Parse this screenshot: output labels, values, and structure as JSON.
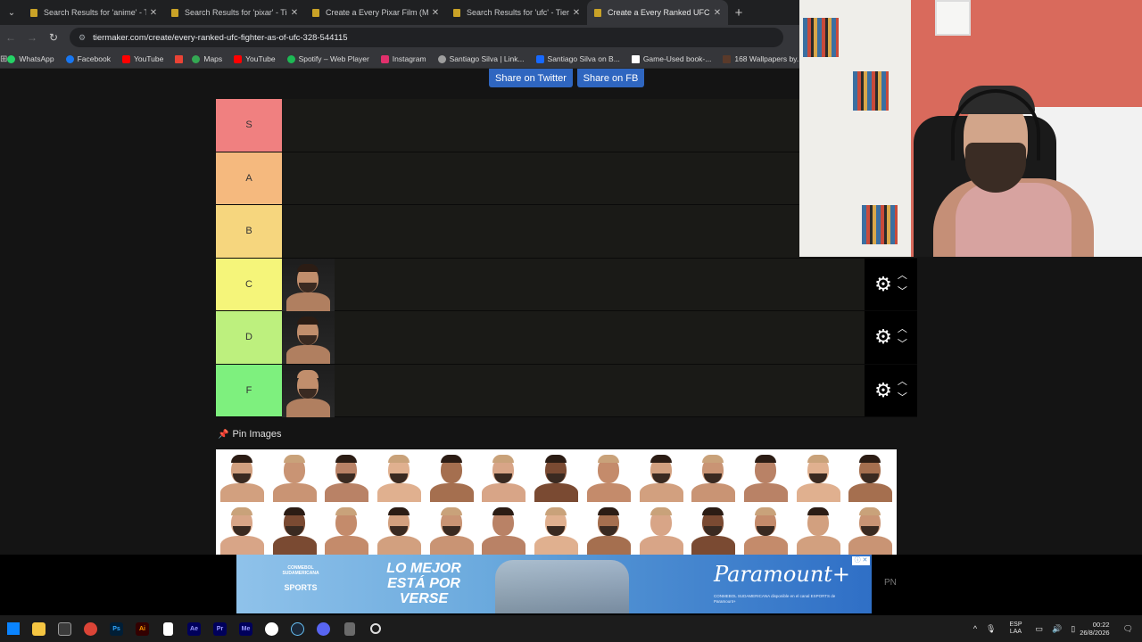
{
  "browser": {
    "tabs": [
      {
        "title": "Search Results for 'anime' - Tier",
        "active": false
      },
      {
        "title": "Search Results for 'pixar' - TierM",
        "active": false
      },
      {
        "title": "Create a Every Pixar Film (Marc",
        "active": false
      },
      {
        "title": "Search Results for 'ufc' - TierMa",
        "active": false
      },
      {
        "title": "Create a Every Ranked UFC Figh",
        "active": true
      }
    ],
    "url": "tiermaker.com/create/every-ranked-ufc-fighter-as-of-ufc-328-544115",
    "bookmarks": [
      {
        "label": "WhatsApp",
        "color": "#25d366"
      },
      {
        "label": "Facebook",
        "color": "#1877f2"
      },
      {
        "label": "YouTube",
        "color": "#ff0000"
      },
      {
        "label": "",
        "color": "#ea4335"
      },
      {
        "label": "Maps",
        "color": "#34a853"
      },
      {
        "label": "YouTube",
        "color": "#ff0000"
      },
      {
        "label": "Spotify – Web Player",
        "color": "#1db954"
      },
      {
        "label": "Instagram",
        "color": "#e1306c"
      },
      {
        "label": "Santiago Silva | Link...",
        "color": "#9e9e9e"
      },
      {
        "label": "Santiago Silva on B...",
        "color": "#1769ff"
      },
      {
        "label": "Game-Used book-...",
        "color": "#ffffff"
      },
      {
        "label": "168 Wallpapers by...",
        "color": "#5a3a2a"
      }
    ]
  },
  "share": {
    "twitter": "Share on Twitter",
    "fb": "Share on FB"
  },
  "tiers": [
    {
      "label": "S",
      "color": "#f08080",
      "count": 0
    },
    {
      "label": "A",
      "color": "#f5b97e",
      "count": 0
    },
    {
      "label": "B",
      "color": "#f6d67e",
      "count": 0
    },
    {
      "label": "C",
      "color": "#f5f57a",
      "count": 1
    },
    {
      "label": "D",
      "color": "#bdf07e",
      "count": 1
    },
    {
      "label": "F",
      "color": "#7ef07e",
      "count": 1
    }
  ],
  "pin_images": "Pin Images",
  "ad": {
    "logo": "CONMEBOL SUDAMERICANA",
    "logo2": "SPORTS",
    "slogan": "LO MEJOR ESTÁ POR VERSE",
    "brand": "Paramount+",
    "fine": "CONMEBOL SUDAMERICANA disponible en el canal ESPORTS de Paramount+"
  },
  "pn": "PN",
  "taskbar": {
    "apps": [
      "start",
      "explorer",
      "store",
      "chrome",
      "photoshop",
      "illustrator",
      "notepad",
      "after-effects",
      "premiere",
      "media-encoder",
      "obs",
      "steam",
      "discord",
      "calculator",
      "snipping-tool"
    ],
    "lang": "ESP\nLAA",
    "time": "00:22",
    "date": "26/8/2026"
  }
}
